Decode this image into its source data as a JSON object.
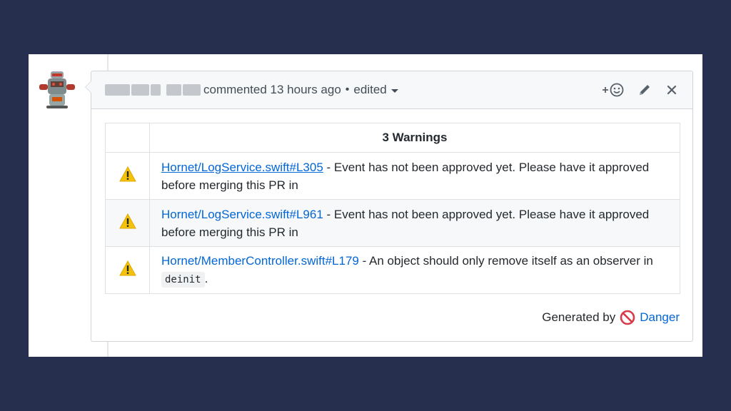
{
  "comment": {
    "action_text": "commented 13 hours ago",
    "separator": "•",
    "edited_label": "edited",
    "icons": {
      "reaction": "add-reaction-icon",
      "edit": "pencil-icon",
      "close": "close-icon",
      "warning": "warning-icon",
      "danger": "no-entry-icon"
    }
  },
  "warnings_table": {
    "header": "3 Warnings",
    "rows": [
      {
        "link": "Hornet/LogService.swift#L305",
        "text": " - Event has not been approved yet. Please have it approved before merging this PR in"
      },
      {
        "link": "Hornet/LogService.swift#L961",
        "text": " - Event has not been approved yet. Please have it approved before merging this PR in"
      },
      {
        "link": "Hornet/MemberController.swift#L179",
        "text_before_code": " - An object should only remove itself as an observer in ",
        "code": "deinit",
        "text_after_code": "."
      }
    ]
  },
  "footer": {
    "generated_by": "Generated by",
    "danger_label": "Danger"
  },
  "colors": {
    "background": "#262f4e",
    "link": "#0366d6",
    "warning": "#f4c20d",
    "danger": "#d73a49"
  }
}
